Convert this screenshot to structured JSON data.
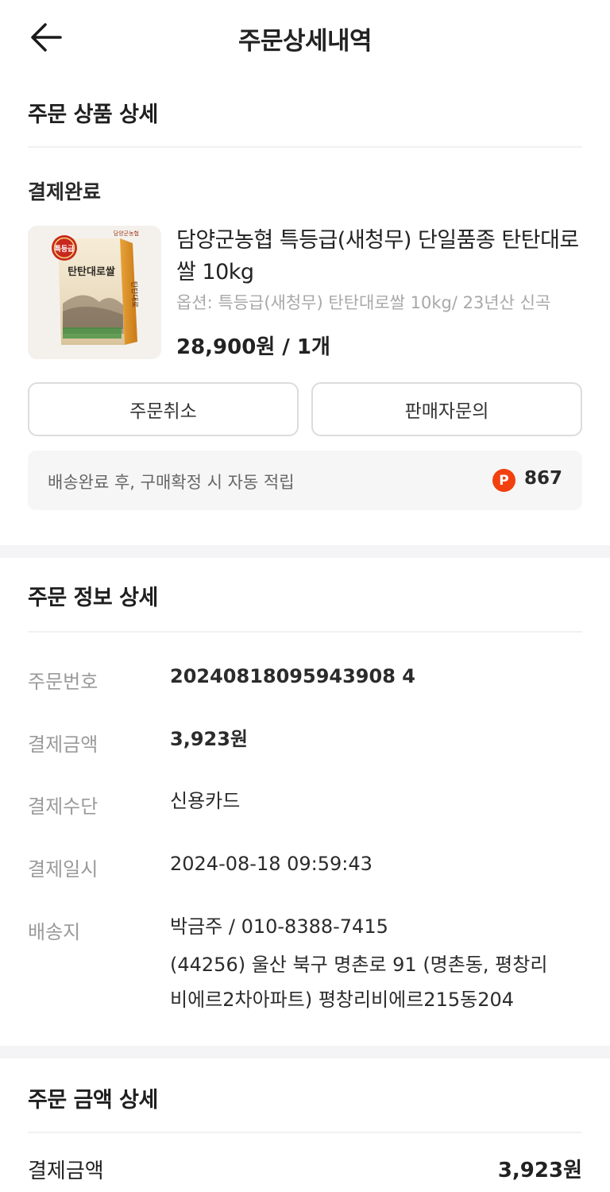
{
  "header": {
    "title": "주문상세내역",
    "back_icon": "arrow-left-icon"
  },
  "product_section": {
    "title": "주문 상품 상세",
    "status": "결제완료",
    "product": {
      "name": "담양군농협 특등급(새청무) 단일품종 탄탄대로쌀 10kg",
      "option": "옵션: 특등급(새청무) 탄탄대로쌀 10kg/ 23년산 신곡",
      "price_qty": "28,900원 / 1개",
      "image_badge": "특등급",
      "image_brand": "탄탄대로쌀",
      "image_maker": "담양군농협"
    },
    "buttons": {
      "cancel": "주문취소",
      "inquiry": "판매자문의"
    },
    "points": {
      "text": "배송완료 후, 구매확정 시 자동 적립",
      "icon_letter": "P",
      "value": "867",
      "icon_color": "#f2400f"
    }
  },
  "order_info": {
    "title": "주문 정보 상세",
    "rows": [
      {
        "label": "주문번호",
        "value": "20240818095943908 4"
      },
      {
        "label": "결제금액",
        "value": "3,923원"
      },
      {
        "label": "결제수단",
        "value": "신용카드"
      },
      {
        "label": "결제일시",
        "value": "2024-08-18 09:59:43"
      },
      {
        "label": "배송지",
        "value": "박금주 / 010-8388-7415"
      }
    ],
    "address_lines": [
      "(44256) 울산 북구 명촌로 91 (명촌동, 평창리",
      "비에르2차아파트) 평창리비에르215동204"
    ]
  },
  "amount_section": {
    "title": "주문 금액 상세",
    "total_label": "결제금액",
    "total_value": "3,923원"
  }
}
